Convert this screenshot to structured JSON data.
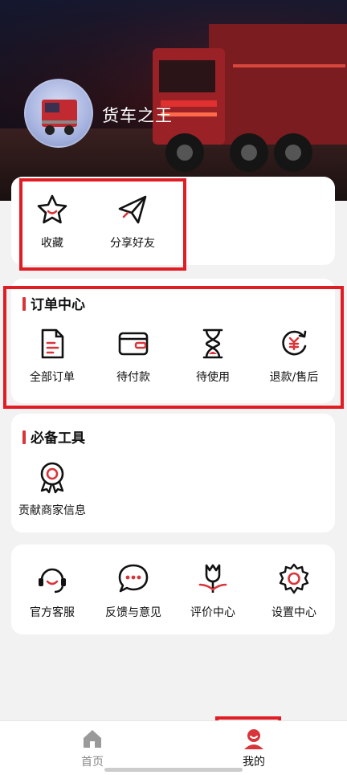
{
  "profile": {
    "username": "货车之王"
  },
  "favorites": {
    "items": [
      {
        "label": "收藏",
        "icon": "star-icon"
      },
      {
        "label": "分享好友",
        "icon": "paper-plane-icon"
      }
    ]
  },
  "orders": {
    "title": "订单中心",
    "items": [
      {
        "label": "全部订单",
        "icon": "document-icon"
      },
      {
        "label": "待付款",
        "icon": "wallet-icon"
      },
      {
        "label": "待使用",
        "icon": "hourglass-icon"
      },
      {
        "label": "退款/售后",
        "icon": "refund-icon"
      }
    ]
  },
  "tools": {
    "title": "必备工具",
    "items": [
      {
        "label": "贡献商家信息",
        "icon": "badge-icon"
      }
    ]
  },
  "services": {
    "items": [
      {
        "label": "官方客服",
        "icon": "headset-icon"
      },
      {
        "label": "反馈与意见",
        "icon": "chat-bubble-icon"
      },
      {
        "label": "评价中心",
        "icon": "rating-flower-icon"
      },
      {
        "label": "设置中心",
        "icon": "settings-gear-icon"
      }
    ]
  },
  "tabbar": {
    "items": [
      {
        "label": "首页",
        "icon": "home-icon",
        "active": false
      },
      {
        "label": "我的",
        "icon": "profile-icon",
        "active": true
      }
    ]
  },
  "colors": {
    "accent": "#d8353a",
    "highlight": "#e01c24",
    "inactive": "#888888"
  }
}
